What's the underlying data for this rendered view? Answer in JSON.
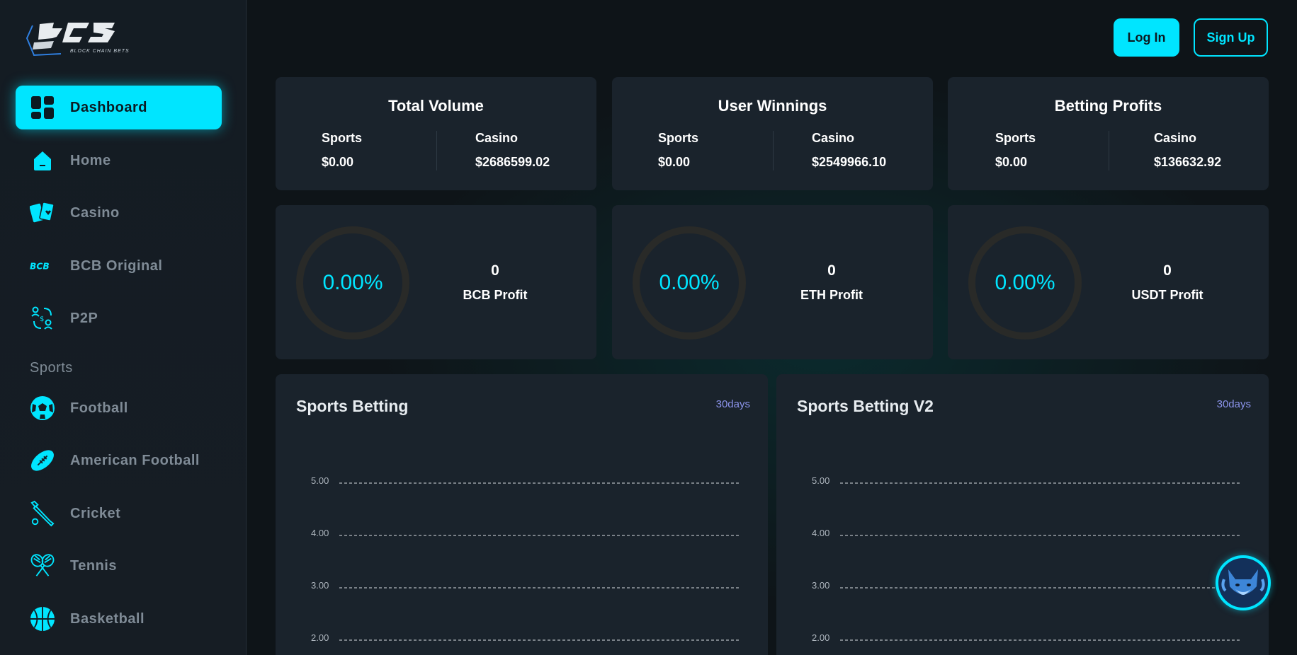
{
  "brand": {
    "logo_text": "BCB",
    "tagline": "BLOCK CHAIN BETS"
  },
  "sidebar": {
    "items": [
      {
        "label": "Dashboard",
        "icon": "dashboard-icon"
      },
      {
        "label": "Home",
        "icon": "home-icon"
      },
      {
        "label": "Casino",
        "icon": "cards-icon"
      },
      {
        "label": "BCB Original",
        "icon": "bcb-logo-icon"
      },
      {
        "label": "P2P",
        "icon": "p2p-icon"
      }
    ],
    "sports_heading": "Sports",
    "sports": [
      {
        "label": "Football",
        "icon": "soccer-ball-icon"
      },
      {
        "label": "American Football",
        "icon": "american-football-icon"
      },
      {
        "label": "Cricket",
        "icon": "cricket-bat-icon"
      },
      {
        "label": "Tennis",
        "icon": "tennis-rackets-icon"
      },
      {
        "label": "Basketball",
        "icon": "basketball-icon"
      }
    ]
  },
  "header": {
    "login_label": "Log In",
    "signup_label": "Sign Up"
  },
  "stats": [
    {
      "title": "Total Volume",
      "sports_label": "Sports",
      "sports_value": "$0.00",
      "casino_label": "Casino",
      "casino_value": "$2686599.02"
    },
    {
      "title": "User Winnings",
      "sports_label": "Sports",
      "sports_value": "$0.00",
      "casino_label": "Casino",
      "casino_value": "$2549966.10"
    },
    {
      "title": "Betting Profits",
      "sports_label": "Sports",
      "sports_value": "$0.00",
      "casino_label": "Casino",
      "casino_value": "$136632.92"
    }
  ],
  "profits": [
    {
      "percent": "0.00%",
      "value": "0",
      "label": "BCB Profit"
    },
    {
      "percent": "0.00%",
      "value": "0",
      "label": "ETH Profit"
    },
    {
      "percent": "0.00%",
      "value": "0",
      "label": "USDT Profit"
    }
  ],
  "colors": {
    "accent": "#00e5ff",
    "card": "#1a232c",
    "ring": "#292a28",
    "period": "#8b93ea"
  },
  "chart_data": [
    {
      "type": "line",
      "title": "Sports Betting",
      "period": "30days",
      "y_ticks": [
        "5.00",
        "4.00",
        "3.00",
        "2.00"
      ],
      "ylim": [
        2,
        5
      ],
      "grid": true,
      "series": []
    },
    {
      "type": "line",
      "title": "Sports Betting V2",
      "period": "30days",
      "y_ticks": [
        "5.00",
        "4.00",
        "3.00",
        "2.00"
      ],
      "ylim": [
        2,
        5
      ],
      "grid": true,
      "series": []
    }
  ]
}
